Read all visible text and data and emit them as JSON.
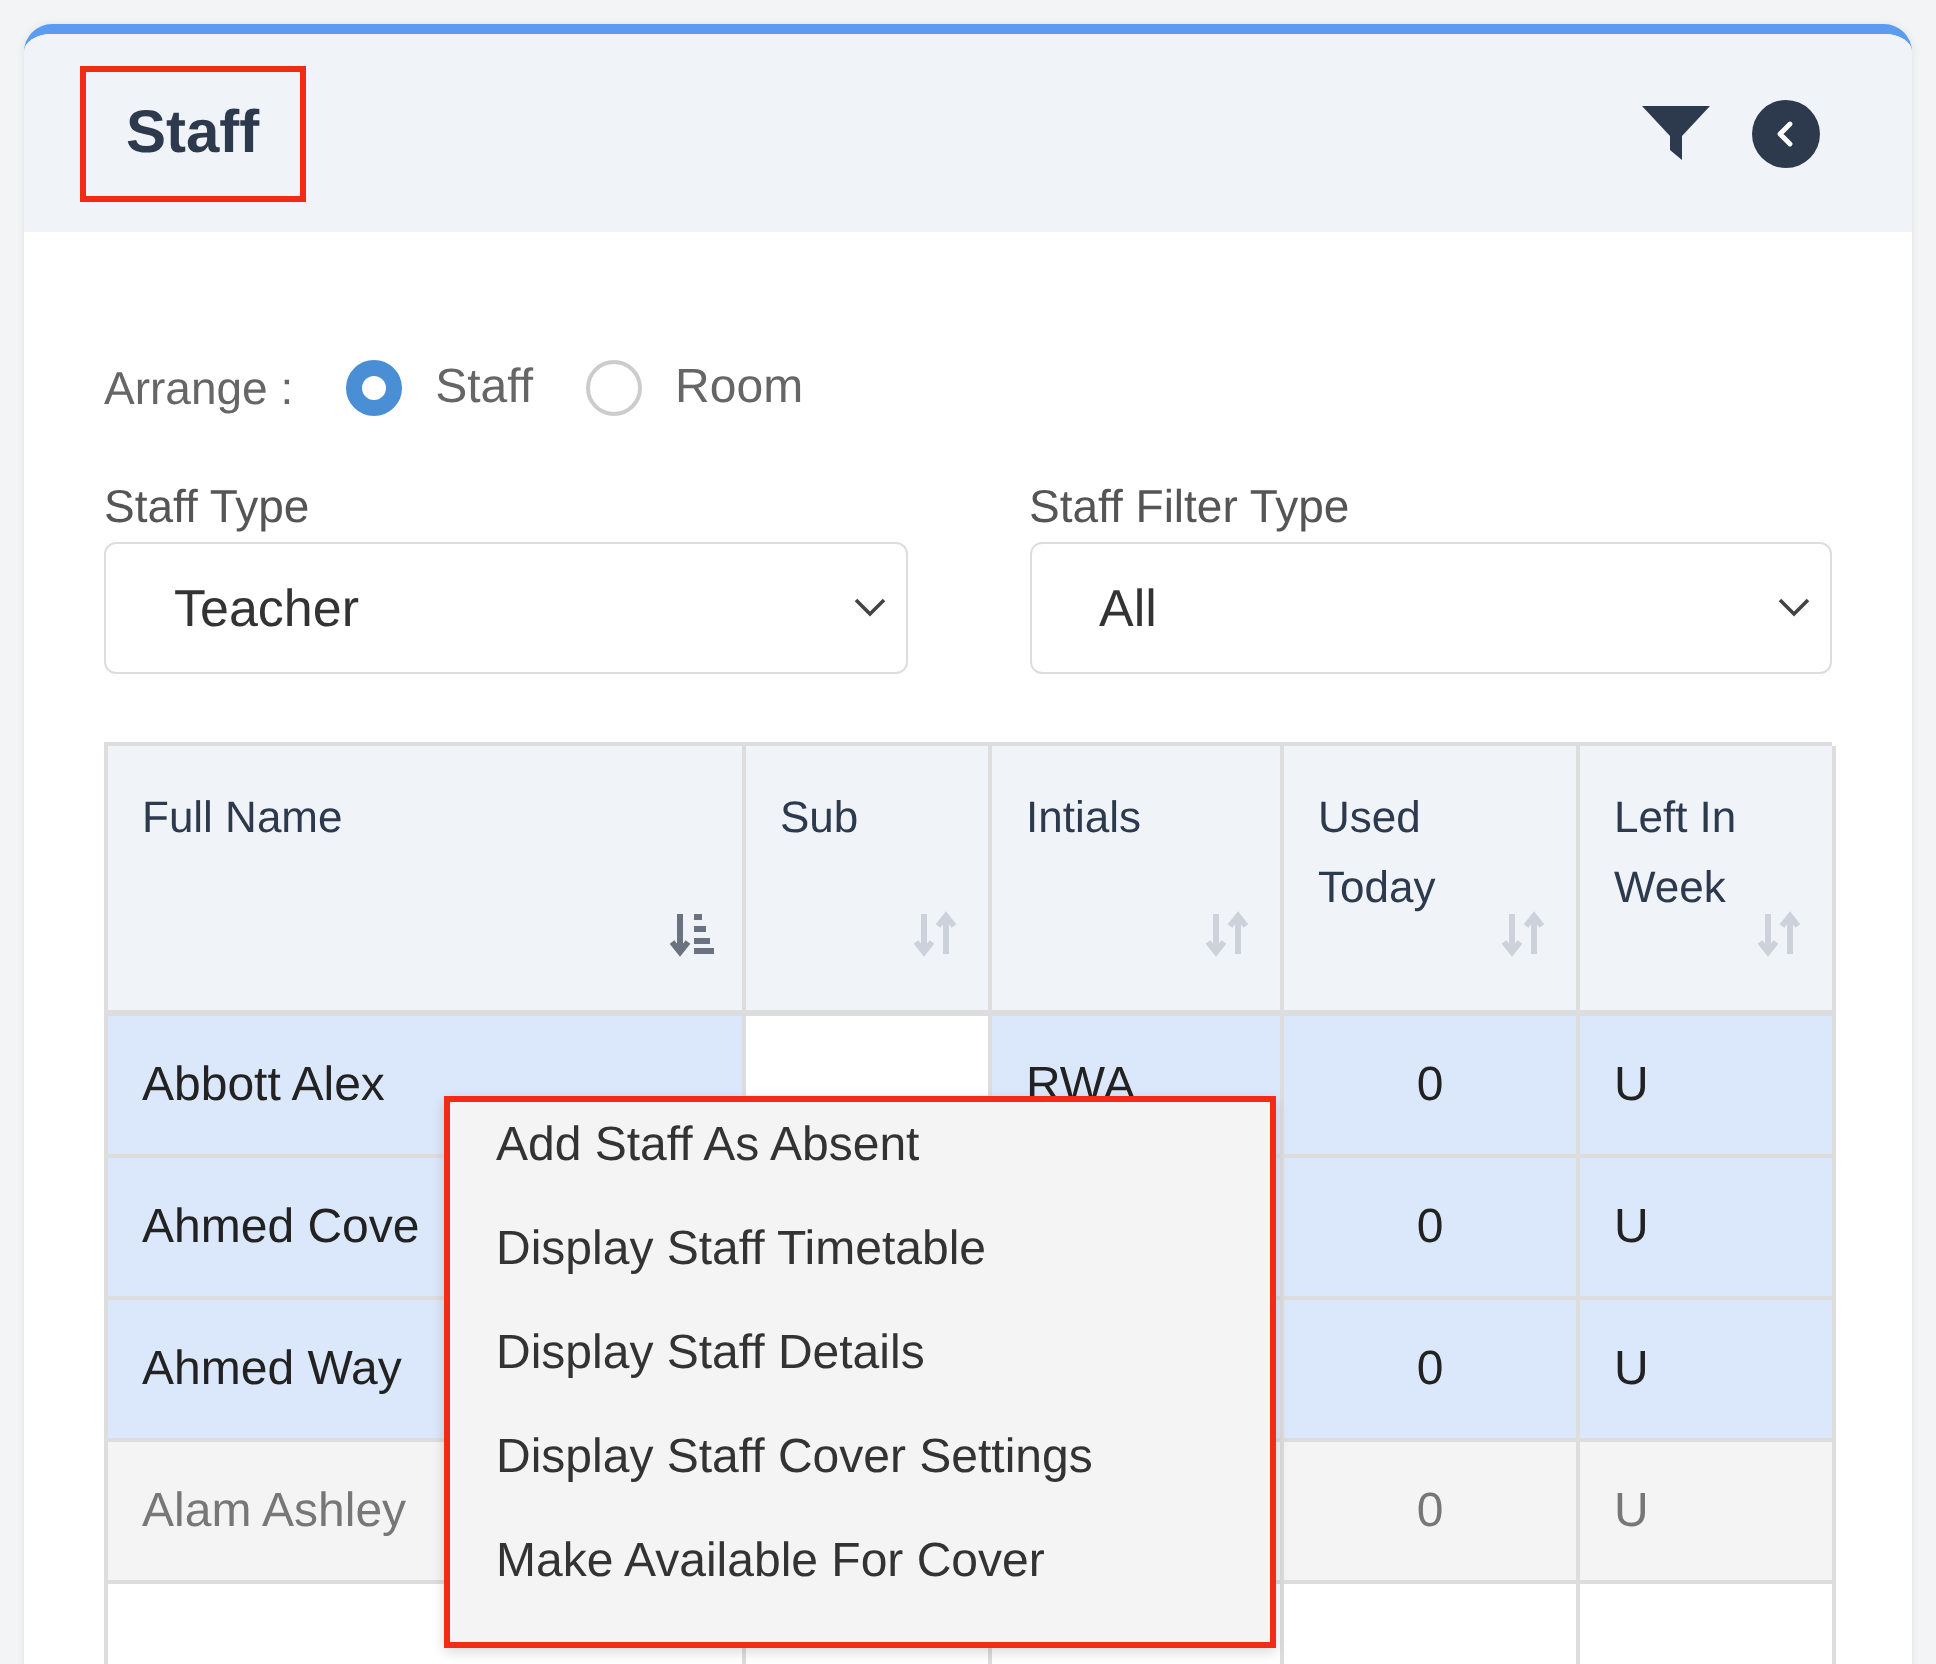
{
  "panel": {
    "title": "Staff",
    "title_highlighted": true
  },
  "arrange": {
    "label": "Arrange :",
    "options": [
      {
        "label": "Staff",
        "selected": true
      },
      {
        "label": "Room",
        "selected": false
      }
    ]
  },
  "filters": [
    {
      "label": "Staff Type",
      "value": "Teacher"
    },
    {
      "label": "Staff Filter Type",
      "value": "All"
    }
  ],
  "table": {
    "columns": [
      {
        "label": "Full Name",
        "sorted": true,
        "kind": "text"
      },
      {
        "label": "Sub",
        "sorted": false,
        "kind": "text"
      },
      {
        "label": "Intials",
        "sorted": false,
        "kind": "text"
      },
      {
        "label": "Used Today",
        "sorted": false,
        "kind": "count"
      },
      {
        "label": "Left In Week",
        "sorted": false,
        "kind": "text"
      }
    ],
    "rows": [
      {
        "selected": true,
        "disabled": false,
        "cells": [
          "Abbott Alex",
          "",
          "RWA",
          "0",
          "U"
        ]
      },
      {
        "selected": true,
        "disabled": false,
        "cells": [
          "Ahmed Cove",
          "",
          "",
          "0",
          "U"
        ]
      },
      {
        "selected": true,
        "disabled": false,
        "cells": [
          "Ahmed Way",
          "",
          "",
          "0",
          "U"
        ]
      },
      {
        "selected": false,
        "disabled": true,
        "cells": [
          "Alam Ashley",
          "",
          "",
          "0",
          "U"
        ]
      },
      {
        "cells": [
          "",
          "",
          "",
          "",
          ""
        ]
      }
    ]
  },
  "context_menu": {
    "highlighted": true,
    "items": [
      "Add Staff As Absent",
      "Display Staff Timetable",
      "Display Staff Details",
      "Display Staff Cover Settings",
      "Make Available For Cover"
    ]
  }
}
